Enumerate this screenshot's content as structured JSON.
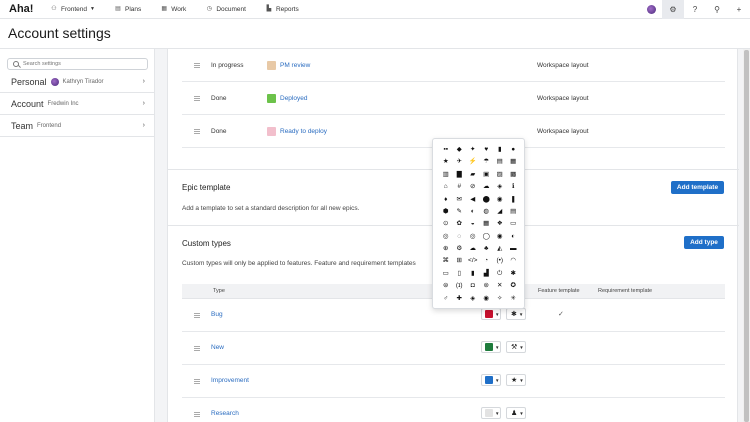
{
  "app": {
    "logo": "Aha!"
  },
  "topnav": {
    "workspace": "Frontend",
    "items": [
      {
        "label": "Plans",
        "icon": "plans-icon"
      },
      {
        "label": "Work",
        "icon": "work-icon"
      },
      {
        "label": "Document",
        "icon": "document-icon"
      },
      {
        "label": "Reports",
        "icon": "reports-icon"
      }
    ]
  },
  "page": {
    "title": "Account settings"
  },
  "sidebar": {
    "search_placeholder": "Search settings",
    "items": [
      {
        "label": "Personal",
        "sub": "Kathryn Tirador"
      },
      {
        "label": "Account",
        "sub": "Fredwin Inc"
      },
      {
        "label": "Team",
        "sub": "Frontend"
      }
    ]
  },
  "statuses": [
    {
      "category": "In progress",
      "name": "PM review",
      "color": "#e8c9a6",
      "layout": "Workspace layout"
    },
    {
      "category": "Done",
      "name": "Deployed",
      "color": "#6cc24a",
      "layout": "Workspace layout"
    },
    {
      "category": "Done",
      "name": "Ready to deploy",
      "color": "#f2bfcc",
      "layout": "Workspace layout"
    }
  ],
  "epic_template": {
    "title": "Epic template",
    "description": "Add a template to set a standard description for all new epics.",
    "button": "Add template"
  },
  "custom_types": {
    "title": "Custom types",
    "description": "Custom types will only be applied to features. Feature and requirement templates",
    "button": "Add type",
    "columns": {
      "type": "Type",
      "feature_template": "Feature template",
      "requirement_template": "Requirement template"
    },
    "rows": [
      {
        "name": "Bug",
        "color": "#c8102e",
        "icon": "bug-icon",
        "glyph": "✱",
        "feature_template": "✓"
      },
      {
        "name": "New",
        "color": "#1e7b3c",
        "icon": "hammer-icon",
        "glyph": "⚒",
        "feature_template": ""
      },
      {
        "name": "Improvement",
        "color": "#1f6fc8",
        "icon": "star-icon",
        "glyph": "★",
        "feature_template": ""
      },
      {
        "name": "Research",
        "color": "#e3e3e3",
        "icon": "person-icon",
        "glyph": "♟",
        "feature_template": ""
      }
    ]
  },
  "icon_picker": {
    "glyphs": [
      "▪▪",
      "◆",
      "✦",
      "♥",
      "▮",
      "●",
      "★",
      "✈",
      "⚡",
      "☂",
      "▤",
      "▦",
      "▥",
      "▇",
      "▰",
      "▣",
      "▨",
      "▩",
      "⌂",
      "#",
      "⊘",
      "☁",
      "◈",
      "ℹ",
      "♦",
      "✉",
      "◀",
      "⬤",
      "◉",
      "❚",
      "⬢",
      "✎",
      "◐",
      "◍",
      "◢",
      "▤",
      "⊙",
      "✿",
      "◒",
      "▦",
      "❖",
      "▭",
      "◎",
      "◌",
      "◎",
      "◯",
      "◉",
      "◐",
      "⊕",
      "⚙",
      "☁",
      "♣",
      "◭",
      "▬",
      "⌘",
      "⊞",
      "</>",
      "◔",
      "(•)",
      "◠",
      "▭",
      "▯",
      "▮",
      "▟",
      "⏻",
      "✱",
      "⊜",
      "(ɪ)",
      "◘",
      "⊚",
      "✕",
      "✪",
      "♂",
      "✚",
      "◈",
      "◉",
      "✧",
      "✳"
    ]
  }
}
